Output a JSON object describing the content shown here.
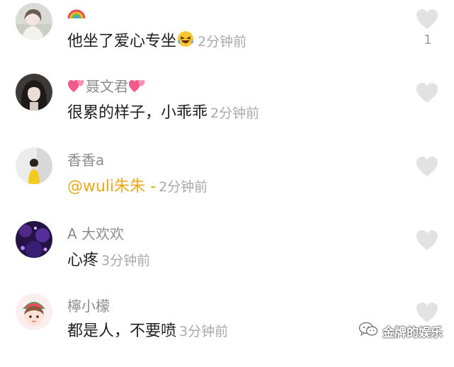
{
  "comments": [
    {
      "username": "",
      "text": "他坐了爱心专坐",
      "time": "2分钟前",
      "likes": "1",
      "avatar": "avatar-girl-light"
    },
    {
      "username": "聂文君",
      "text": "很累的样子，小乖乖",
      "time": "2分钟前",
      "likes": "",
      "avatar": "avatar-girl-dark-hair"
    },
    {
      "username": "香香a",
      "text": "@wuli朱朱 -",
      "time": "2分钟前",
      "likes": "",
      "avatar": "avatar-girl-yellow-coat"
    },
    {
      "username": "A⁠ 大欢欢",
      "text": "心疼",
      "time": "3分钟前",
      "likes": "",
      "avatar": "avatar-purple-lights"
    },
    {
      "username": "檸小檬",
      "text": "都是人，不要喷",
      "time": "3分钟前",
      "likes": "",
      "avatar": "avatar-cartoon-girl"
    }
  ],
  "icons": {
    "like": "heart-icon",
    "rainbow": "rainbow-emoji",
    "laugh": "laughing-crying-emoji",
    "hearts": "two-hearts-emoji",
    "watermark": "wechat-icon"
  },
  "watermark": {
    "text": "金牌的娱乐"
  },
  "colors": {
    "username": "#8c8c8c",
    "comment": "#1f1f1f",
    "time": "#a9a9a9",
    "mention": "#e9a91d",
    "heart": "#e2e2e2"
  }
}
